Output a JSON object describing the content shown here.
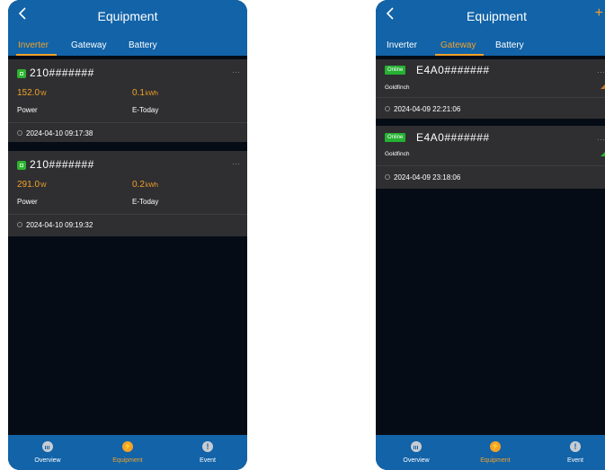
{
  "left": {
    "title": "Equipment",
    "tabs": [
      "Inverter",
      "Gateway",
      "Battery"
    ],
    "active_tab": "Inverter",
    "devices": [
      {
        "serial": "210#######",
        "power": "152.0",
        "power_unit": "W",
        "energy": "0.1",
        "energy_unit": "kWh",
        "power_label": "Power",
        "energy_label": "E-Today",
        "time": "2024-04-10 09:17:38",
        "more": "···"
      },
      {
        "serial": "210#######",
        "power": "291.0",
        "power_unit": "W",
        "energy": "0.2",
        "energy_unit": "kWh",
        "power_label": "Power",
        "energy_label": "E-Today",
        "time": "2024-04-10 09:19:32",
        "more": "···"
      }
    ],
    "bottom_nav": [
      "Overview",
      "Equipment",
      "Event"
    ],
    "active_nav": "Equipment"
  },
  "right": {
    "title": "Equipment",
    "add": "+",
    "tabs": [
      "Inverter",
      "Gateway",
      "Battery"
    ],
    "active_tab": "Gateway",
    "gateways": [
      {
        "status": "Online",
        "serial": "E4A0#######",
        "model": "Goldfinch",
        "time": "2024-04-09 22:21:06",
        "more": "···",
        "signal_color": "#c97a2a"
      },
      {
        "status": "Online",
        "serial": "E4A0#######",
        "model": "Goldfinch",
        "time": "2024-04-09 23:18:06",
        "more": "···",
        "signal_color": "#2db431"
      }
    ],
    "bottom_nav": [
      "Overview",
      "Equipment",
      "Event"
    ],
    "active_nav": "Equipment"
  },
  "colors": {
    "header": "#1263a8",
    "accent": "#f2a22a",
    "card": "#2f2f31",
    "background": "#060c16",
    "online": "#25b132"
  },
  "icons": {
    "back": "chevron-left-icon",
    "nav": [
      "chart-icon",
      "bolt-icon",
      "exclamation-icon"
    ]
  }
}
